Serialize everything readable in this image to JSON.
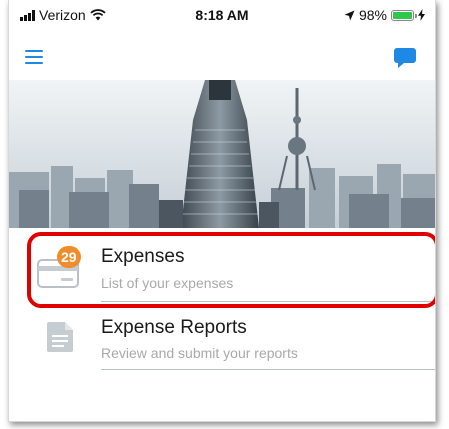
{
  "status_bar": {
    "carrier": "Verizon",
    "time": "8:18 AM",
    "battery": "98%",
    "battery_level": 0.98
  },
  "app_header": {
    "menu_icon": "hamburger-menu-icon",
    "chat_icon": "chat-bubble-icon",
    "accent_color": "#1e88e5"
  },
  "list": {
    "items": [
      {
        "title": "Expenses",
        "subtitle": "List of your expenses",
        "badge": "29",
        "icon": "credit-card-icon"
      },
      {
        "title": "Expense Reports",
        "subtitle": "Review and submit your reports",
        "icon": "document-icon"
      }
    ]
  },
  "colors": {
    "highlight": "#e00000",
    "badge": "#f08c2a"
  }
}
